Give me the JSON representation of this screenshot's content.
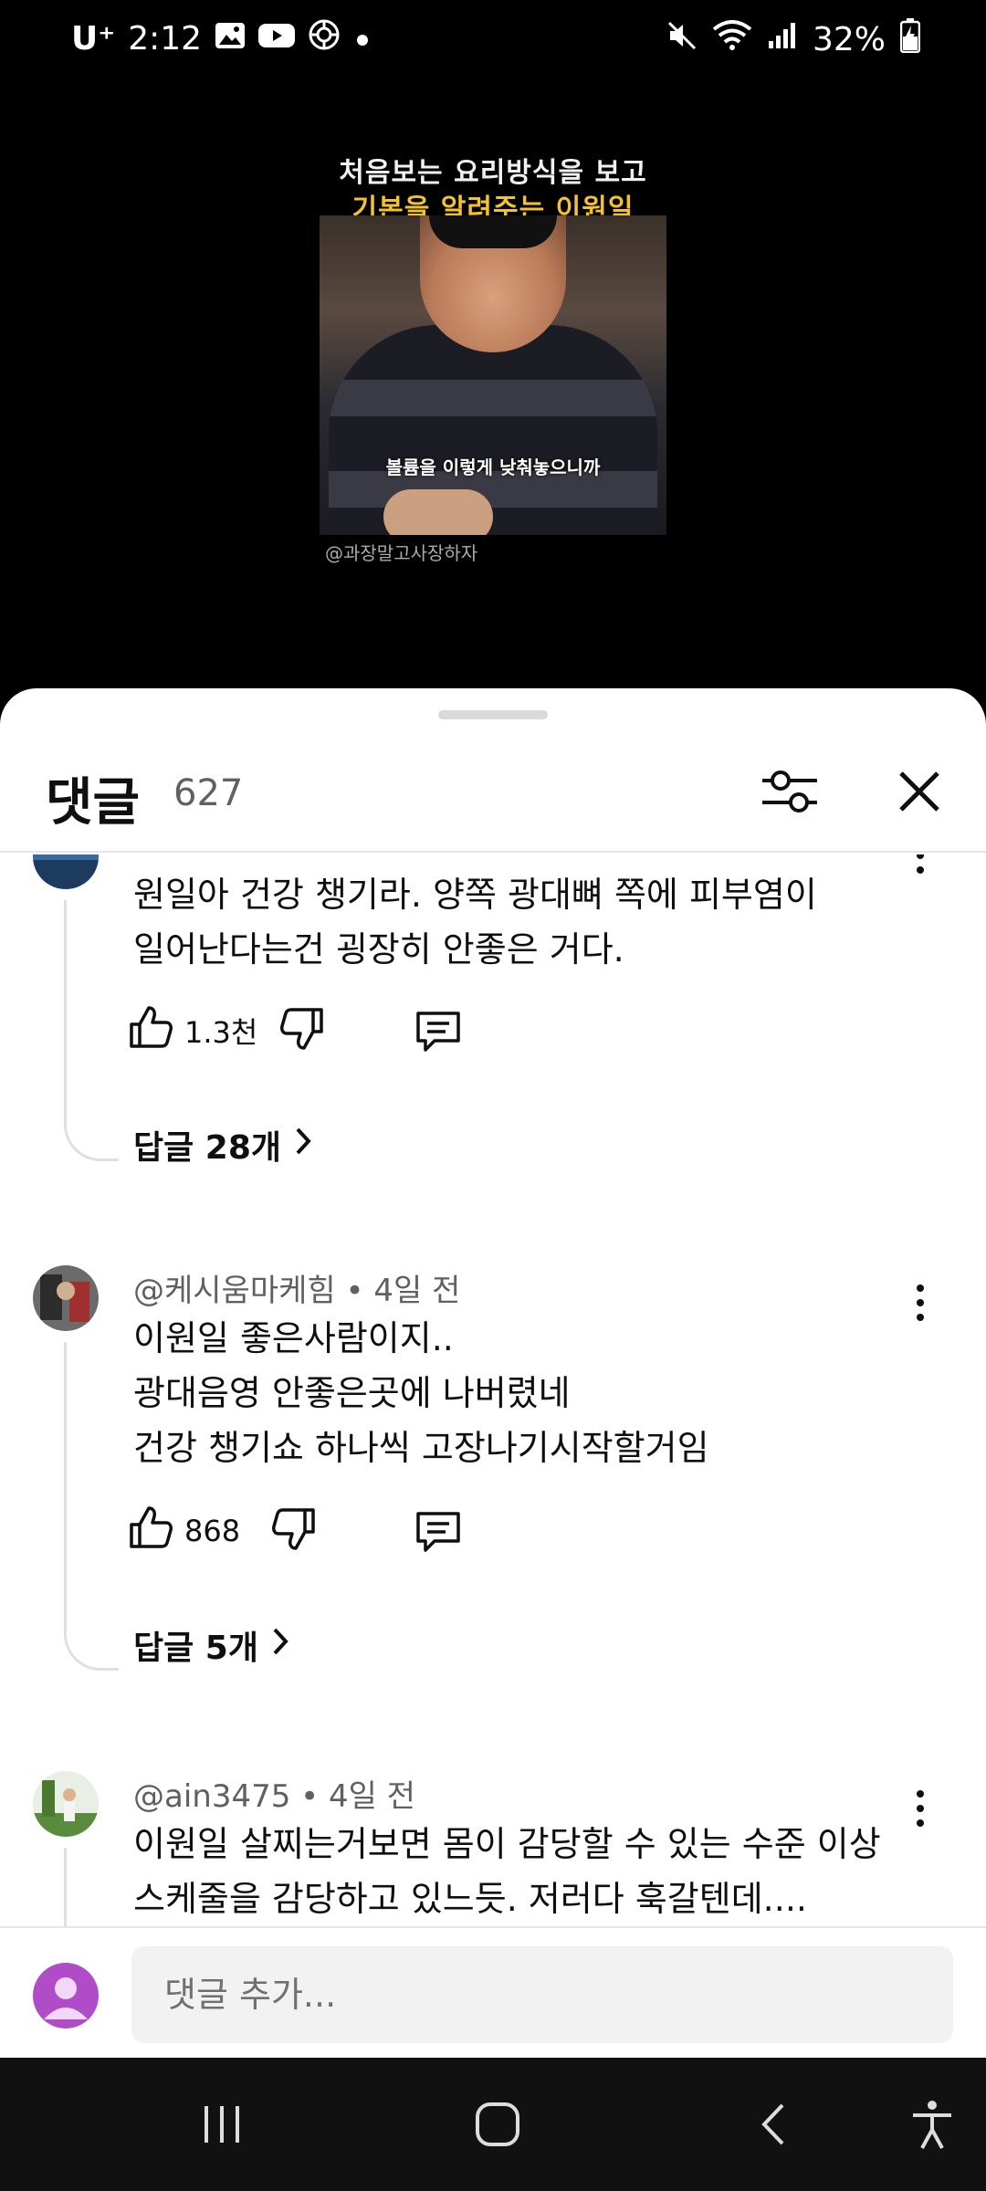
{
  "status_bar": {
    "carrier": "U⁺",
    "time": "2:12",
    "battery": "32%",
    "icons": [
      "gallery-icon",
      "youtube-icon",
      "settings-flower-icon",
      "dot-icon",
      "mute-icon",
      "wifi-icon",
      "signal-icon",
      "battery-charging-icon"
    ]
  },
  "video": {
    "caption_line1": "처음보는 요리방식을 보고",
    "caption_line2": "기본을 알려주는 이원일",
    "subtitle": "볼륨을 이렇게 낮춰놓으니까",
    "channel_handle": "@과장말고사장하자"
  },
  "comments_panel": {
    "title": "댓글",
    "count": "627",
    "filter_icon": "filter-sliders-icon",
    "close_icon": "close-icon"
  },
  "comments": [
    {
      "author": "",
      "text": "원일아 건강 챙기라. 양쪽 광대뼈 쪽에  피부염이\n일어난다는건 굉장히 안좋은 거다.",
      "likes": "1.3천",
      "replies": "답글 28개"
    },
    {
      "author": "@케시움마케힘",
      "age": "4일 전",
      "text": "이원일 좋은사람이지..\n광대음영 안좋은곳에 나버렸네\n건강 챙기쇼 하나씩 고장나기시작할거임",
      "likes": "868",
      "replies": "답글 5개"
    },
    {
      "author": "@ain3475",
      "age": "4일 전",
      "text": "이원일 살찌는거보면 몸이 감당할 수 있는 수준 이상\n스케줄을 감당하고 있느듯. 저러다 훅갈텐데...."
    }
  ],
  "composer": {
    "placeholder": "댓글 추가..."
  },
  "colors": {
    "sheet_bg": "#ffffff",
    "caption_yellow": "#f2c230",
    "secondary_text": "#606060",
    "composer_avatar": "#b04cc8"
  }
}
